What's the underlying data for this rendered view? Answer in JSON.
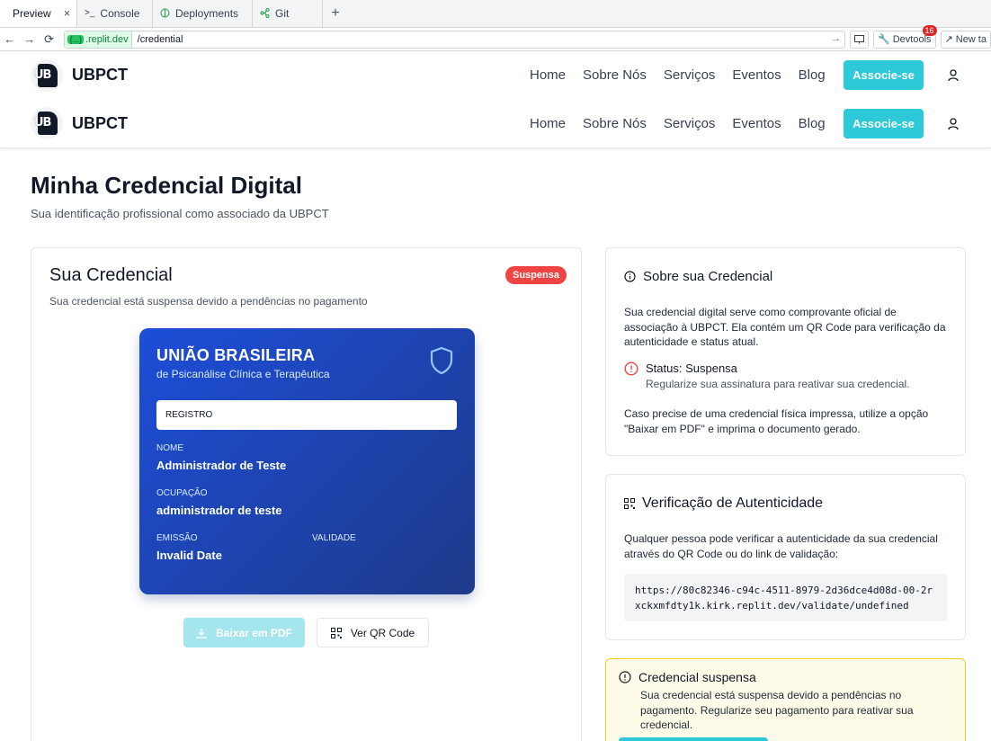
{
  "browser": {
    "tabs": [
      {
        "label": "Preview",
        "icon": "monitor-icon",
        "close": "×"
      },
      {
        "label": "Console",
        "icon": "terminal-icon"
      },
      {
        "label": "Deployments",
        "icon": "globe-icon"
      },
      {
        "label": "Git",
        "icon": "git-branch-icon"
      }
    ],
    "new_tab": "+",
    "url_host_badge": "{...}",
    "url_host": ".replit.dev",
    "url_path": "/credential",
    "devtools_label": "Devtools",
    "devtools_count": "16",
    "new_tab_label": "New ta"
  },
  "header": {
    "brand": "UBPCT",
    "logo_text": "UB",
    "nav": [
      "Home",
      "Sobre Nós",
      "Serviços",
      "Eventos",
      "Blog"
    ],
    "cta": "Associe-se"
  },
  "page": {
    "title": "Minha Credencial Digital",
    "subtitle": "Sua identificação profissional como associado da UBPCT"
  },
  "credential": {
    "title": "Sua Credencial",
    "status_badge": "Suspensa",
    "description": "Sua credencial está suspensa devido a pendências no pagamento",
    "card": {
      "org_line1": "UNIÃO BRASILEIRA",
      "org_line2": "de Psicanálise Clínica e Terapêutica",
      "registro_label": "REGISTRO",
      "nome_label": "NOME",
      "nome_value": "Administrador de Teste",
      "ocupacao_label": "OCUPAÇÃO",
      "ocupacao_value": "administrador de teste",
      "emissao_label": "EMISSÃO",
      "emissao_value": "Invalid Date",
      "validade_label": "VALIDADE"
    },
    "btn_pdf": "Baixar em PDF",
    "btn_qr": "Ver QR Code"
  },
  "about": {
    "title": "Sobre sua Credencial",
    "text": "Sua credencial digital serve como comprovante oficial de associação à UBPCT. Ela contém um QR Code para verificação da autenticidade e status atual.",
    "status_label": "Status: Suspensa",
    "status_hint": "Regularize sua assinatura para reativar sua credencial.",
    "footer": "Caso precise de uma credencial física impressa, utilize a opção \"Baixar em PDF\" e imprima o documento gerado."
  },
  "verify": {
    "title": "Verificação de Autenticidade",
    "text": "Qualquer pessoa pode verificar a autenticidade da sua credencial através do QR Code ou do link de validação:",
    "link": "https://80c82346-c94c-4511-8979-2d36dce4d08d-00-2rxckxmfdty1k.kirk.replit.dev/validate/undefined"
  },
  "warning": {
    "title": "Credencial suspensa",
    "text": "Sua credencial está suspensa devido a pendências no pagamento. Regularize seu pagamento para reativar sua credencial."
  },
  "colors": {
    "accent": "#2ec9d9",
    "card_blue": "#1d4ed8",
    "danger": "#ef4444",
    "warning_bg": "#fefce8"
  }
}
